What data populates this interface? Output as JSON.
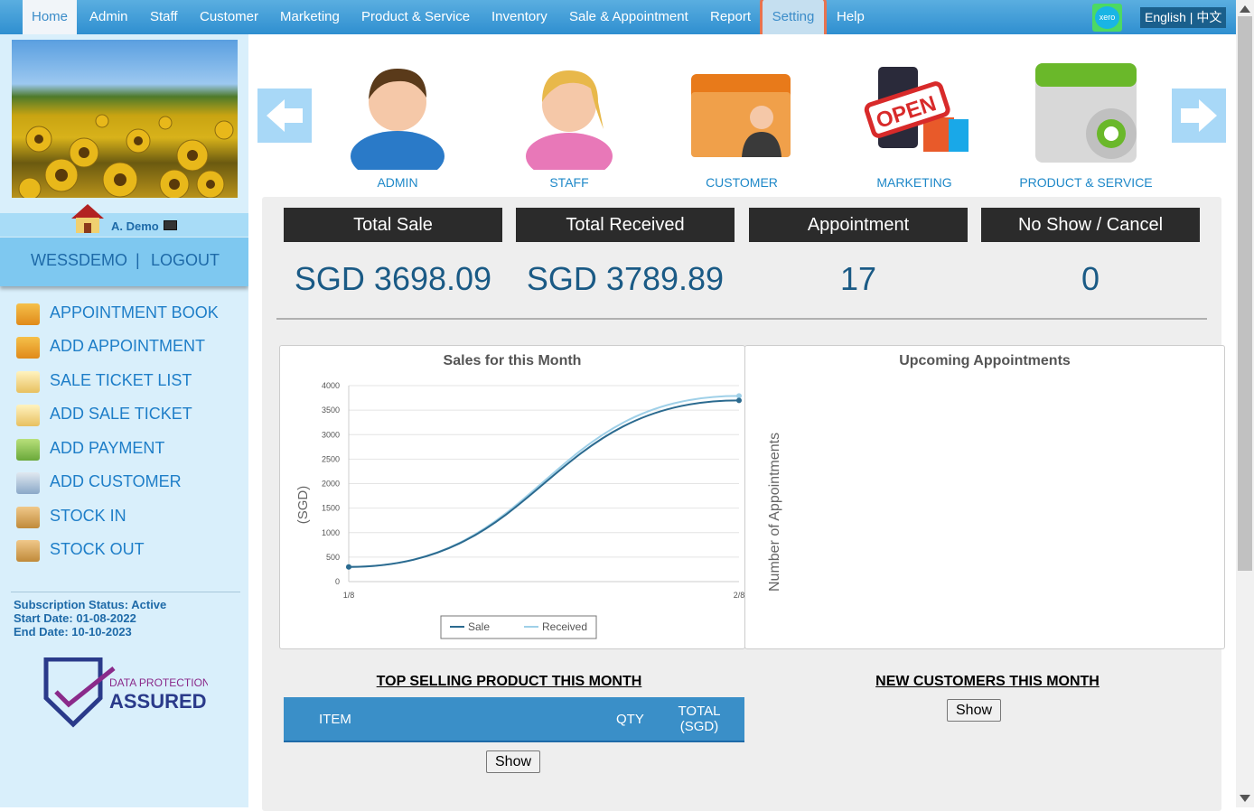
{
  "nav": {
    "items": [
      {
        "label": "Home"
      },
      {
        "label": "Admin"
      },
      {
        "label": "Staff"
      },
      {
        "label": "Customer"
      },
      {
        "label": "Marketing"
      },
      {
        "label": "Product & Service"
      },
      {
        "label": "Inventory"
      },
      {
        "label": "Sale & Appointment"
      },
      {
        "label": "Report"
      },
      {
        "label": "Setting"
      },
      {
        "label": "Help"
      }
    ],
    "active": "Home",
    "xero_label": "xero",
    "language": "English | 中文"
  },
  "sidebar": {
    "user_name": "A. Demo",
    "account_link": "WESSDEMO",
    "separator": "|",
    "logout_link": "LOGOUT",
    "menu": [
      {
        "label": "APPOINTMENT BOOK",
        "icon": "calendar-icon"
      },
      {
        "label": "ADD APPOINTMENT",
        "icon": "calendar-add-icon"
      },
      {
        "label": "SALE TICKET LIST",
        "icon": "receipt-icon"
      },
      {
        "label": "ADD SALE TICKET",
        "icon": "receipt-add-icon"
      },
      {
        "label": "ADD PAYMENT",
        "icon": "money-icon"
      },
      {
        "label": "ADD CUSTOMER",
        "icon": "customer-card-icon"
      },
      {
        "label": "STOCK IN",
        "icon": "box-in-icon"
      },
      {
        "label": "STOCK OUT",
        "icon": "box-out-icon"
      }
    ],
    "subscription": {
      "status": "Subscription Status: Active",
      "start": "Start Date: 01-08-2022",
      "end": "End Date: 10-10-2023"
    },
    "badge": {
      "line1": "DATA PROTECTION",
      "line2": "ASSURED"
    }
  },
  "modules": [
    {
      "label": "ADMIN",
      "icon": "admin-avatar-icon"
    },
    {
      "label": "STAFF",
      "icon": "staff-avatar-icon"
    },
    {
      "label": "CUSTOMER",
      "icon": "customer-folder-icon"
    },
    {
      "label": "MARKETING",
      "icon": "marketing-open-icon"
    },
    {
      "label": "PRODUCT & SERVICE",
      "icon": "product-gear-icon"
    }
  ],
  "stats": [
    {
      "label": "Total Sale",
      "value": "SGD 3698.09"
    },
    {
      "label": "Total Received",
      "value": "SGD 3789.89"
    },
    {
      "label": "Appointment",
      "value": "17"
    },
    {
      "label": "No Show / Cancel",
      "value": "0"
    }
  ],
  "chart_data": {
    "type": "line",
    "title": "Sales for this Month",
    "ylabel": "(SGD)",
    "xlabel": "",
    "categories": [
      "1/8",
      "2/8"
    ],
    "ylim": [
      0,
      4000
    ],
    "yticks": [
      0,
      500,
      1000,
      1500,
      2000,
      2500,
      3000,
      3500,
      4000
    ],
    "series": [
      {
        "name": "Sale",
        "values": [
          300,
          3698.09
        ],
        "color": "#2b6a8f"
      },
      {
        "name": "Received",
        "values": [
          300,
          3789.89
        ],
        "color": "#9fd0e8"
      }
    ],
    "legend": "bottom-center",
    "grid": true
  },
  "appointments_chart": {
    "title": "Upcoming Appointments",
    "ylabel": "Number of Appointments"
  },
  "top_selling": {
    "title": "TOP SELLING PRODUCT THIS MONTH",
    "columns": [
      "ITEM",
      "QTY",
      "TOTAL (SGD)"
    ],
    "show_label": "Show"
  },
  "new_customers": {
    "title": "NEW CUSTOMERS THIS MONTH",
    "show_label": "Show"
  }
}
